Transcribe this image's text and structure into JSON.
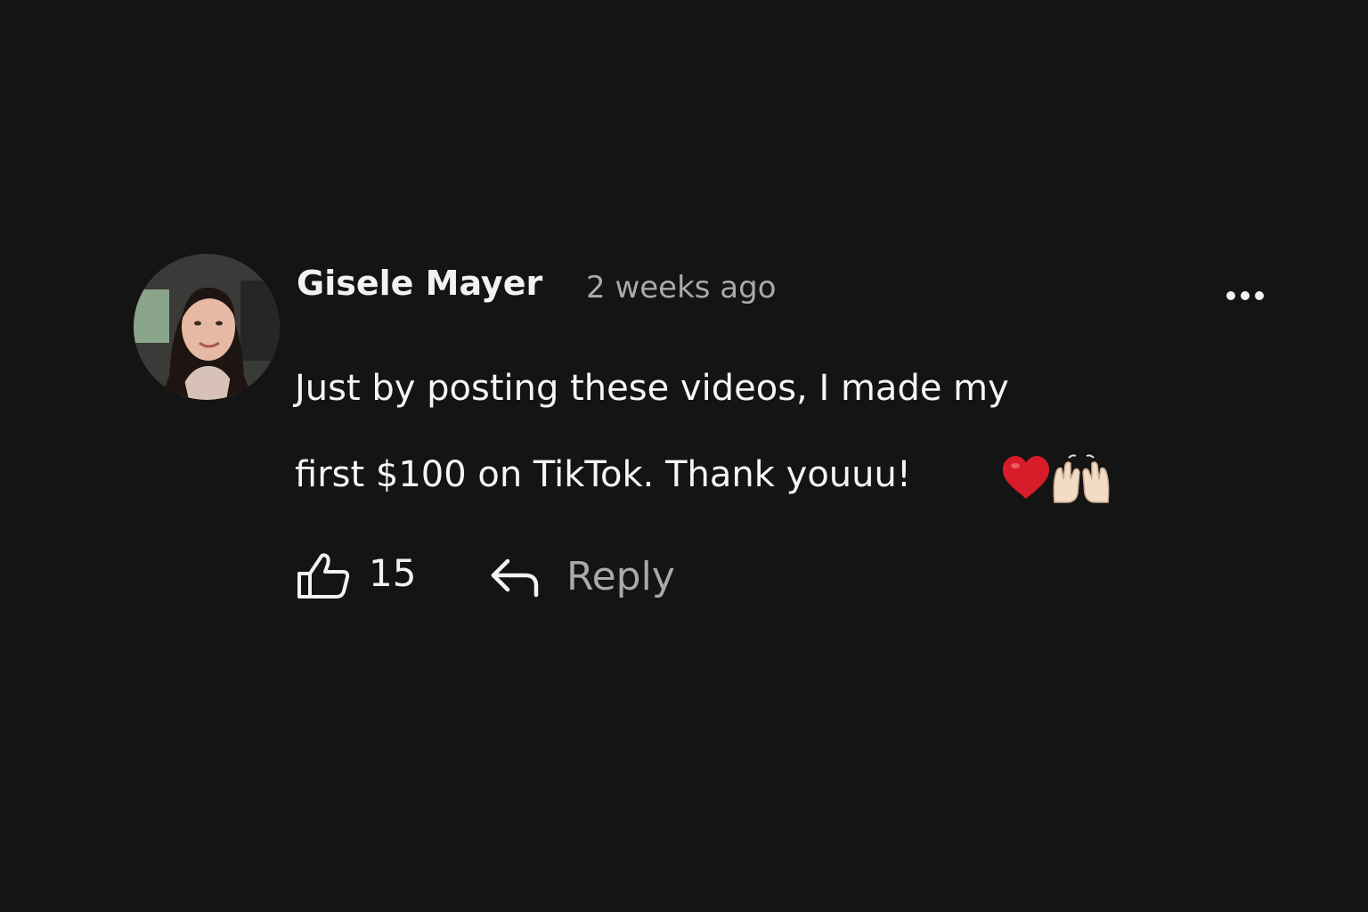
{
  "comment": {
    "author": "Gisele Mayer",
    "time": "2 weeks ago",
    "text_line1": "Just by posting these videos, I made my",
    "text_line2": "first $100 on TikTok. Thank youuu!",
    "emoji": [
      "red-heart",
      "raising-hands-light-skin"
    ],
    "likes": "15",
    "reply_label": "Reply",
    "avatar_alt": "profile photo of smiling woman with long dark hair"
  },
  "icons": {
    "more": "more-horizontal-dots",
    "like": "thumbs-up-outline",
    "reply": "reply-arrow"
  },
  "colors": {
    "background": "#141414",
    "primary_text": "#f5f5f5",
    "secondary_text": "#a9a9a9",
    "heart": "#d91c2a"
  }
}
